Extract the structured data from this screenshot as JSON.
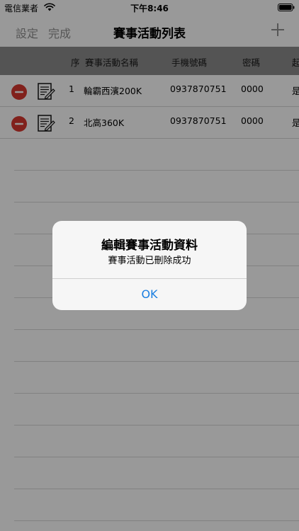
{
  "status_bar": {
    "carrier": "電信業者",
    "time": "下午8:46"
  },
  "nav": {
    "settings_label": "設定",
    "done_label": "完成",
    "title": "賽事活動列表"
  },
  "table": {
    "headers": [
      "序",
      "賽事活動名稱",
      "手機號碼",
      "密碼",
      "起"
    ],
    "rows": [
      {
        "no": "1",
        "name": "輪霸西濱200K",
        "phone": "0937870751",
        "password": "0000",
        "extra": "是"
      },
      {
        "no": "2",
        "name": "北高360K",
        "phone": "0937870751",
        "password": "0000",
        "extra": "是"
      }
    ]
  },
  "alert": {
    "title": "編輯賽事活動資料",
    "message": "賽事活動已刪除成功",
    "ok_label": "OK"
  },
  "colors": {
    "delete_red": "#d8382f",
    "ok_blue": "#1a7ee0",
    "header_gray": "#8c8c8c"
  }
}
